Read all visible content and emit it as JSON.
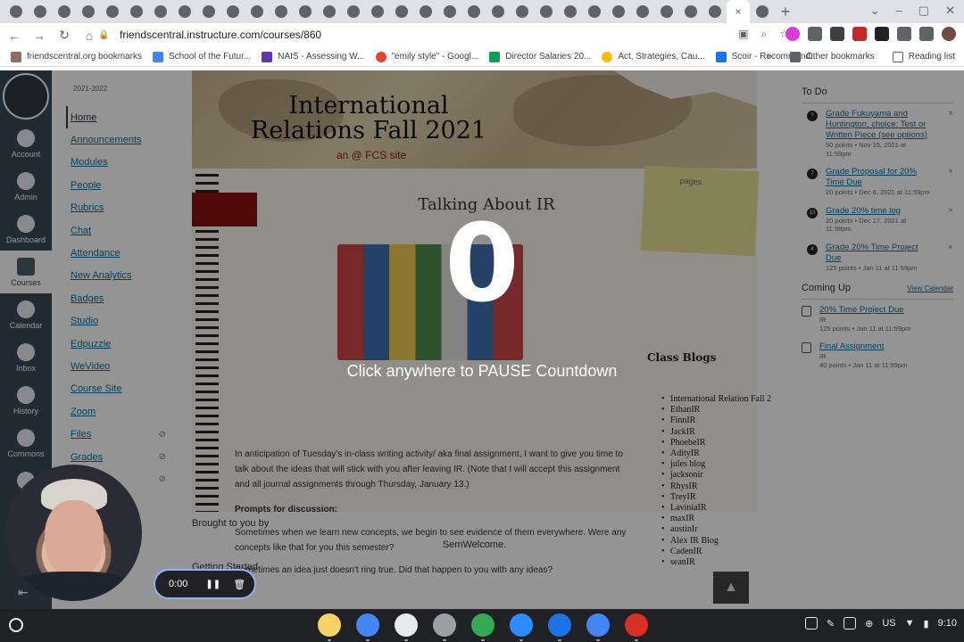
{
  "browser": {
    "tab_count": 32,
    "active_tab_close": "×",
    "new_tab": "+",
    "url": "friendscentral.instructure.com/courses/860",
    "bookmarks": [
      "friendscentral.org bookmarks",
      "School of the Futur...",
      "NAIS - Assessing W...",
      "\"emily style\" - Googl...",
      "Director Salaries 20...",
      "Act, Strategies, Cau...",
      "Scoir - Recommend..."
    ],
    "more_bookmarks": "»",
    "other_bookmarks": "Other bookmarks",
    "reading_list": "Reading list"
  },
  "global_nav": {
    "items": [
      {
        "label": "Account"
      },
      {
        "label": "Admin"
      },
      {
        "label": "Dashboard"
      },
      {
        "label": "Courses"
      },
      {
        "label": "Calendar"
      },
      {
        "label": "Inbox"
      },
      {
        "label": "History"
      },
      {
        "label": "Commons"
      },
      {
        "label": "St..."
      }
    ],
    "active": "Courses"
  },
  "course_nav": {
    "term": "2021-2022",
    "items": [
      {
        "label": "Home",
        "hidden": false
      },
      {
        "label": "Announcements",
        "hidden": false
      },
      {
        "label": "Modules",
        "hidden": false
      },
      {
        "label": "People",
        "hidden": false
      },
      {
        "label": "Rubrics",
        "hidden": false
      },
      {
        "label": "Chat",
        "hidden": false
      },
      {
        "label": "Attendance",
        "hidden": false
      },
      {
        "label": "New Analytics",
        "hidden": false
      },
      {
        "label": "Badges",
        "hidden": false
      },
      {
        "label": "Studio",
        "hidden": false
      },
      {
        "label": "Edpuzzle",
        "hidden": false
      },
      {
        "label": "WeVideo",
        "hidden": false
      },
      {
        "label": "Course Site",
        "hidden": false
      },
      {
        "label": "Zoom",
        "hidden": false
      },
      {
        "label": "Files",
        "hidden": true
      },
      {
        "label": "Grades",
        "hidden": true
      },
      {
        "label": "...ions",
        "hidden": true
      }
    ]
  },
  "page": {
    "banner_title": "International Relations Fall 2021",
    "banner_sub": "an @ FCS site",
    "sticky_note": "pages",
    "section_title": "Talking About IR",
    "intro": "In anticipation of Tuesday's in-class writing activity/ aka final assignment, I want to give you time to talk about the ideas that will stick with you after leaving IR. (Note that I will accept this assignment and all journal assignments through Thursday, January 13.)",
    "prompts_heading": "Prompts for discussion:",
    "prompt1": "Sometimes when we learn new concepts, we begin to see evidence of them everywhere. Were any concepts like that for you this semester?",
    "prompt2": "Sometimes an idea just doesn't ring true. Did that happen to you with any ideas?",
    "brought": "Brought to you by",
    "semwelcome": "SemWelcome.",
    "getting_started": "Getting Started"
  },
  "class_blogs": {
    "title": "Class Blogs",
    "items": [
      "International Relation Fall 2",
      "EthanIR",
      "FinnIR",
      "JackIR",
      "PhoebeIR",
      "AdityIR",
      "jules blog",
      "jacksonir",
      "RhysIR",
      "TreyIR",
      "LaviniaIR",
      "maxIR",
      "austinIr",
      "Alex IR Blog",
      "CadenIR",
      "seanIR"
    ]
  },
  "todo": {
    "title": "To Do",
    "items": [
      {
        "badge": "?",
        "title": "Grade Fukuyama and Huntington, choice: Test or Written Piece (see options)",
        "meta": "50 points • Nov 15, 2021 at 11:59pm"
      },
      {
        "badge": "7",
        "title": "Grade Proposal for 20% Time Due",
        "meta": "20 points • Dec 6, 2021 at 11:59pm"
      },
      {
        "badge": "13",
        "title": "Grade 20% time log",
        "meta": "20 points • Dec 17, 2021 at 11:59pm"
      },
      {
        "badge": "4",
        "title": "Grade 20% Time Project Due",
        "meta": "125 points • Jan 11 at 11:59pm"
      }
    ],
    "dismiss": "×"
  },
  "coming_up": {
    "title": "Coming Up",
    "view_calendar": "View Calendar",
    "items": [
      {
        "title": "20% Time Project Due",
        "course": "IR",
        "meta": "125 points • Jan 11 at 11:59pm"
      },
      {
        "title": "Final Assignment",
        "course": "IR",
        "meta": "40 points • Jan 11 at 11:59pm"
      }
    ]
  },
  "overlay": {
    "countdown": "0",
    "message": "Click anywhere to PAUSE Countdown"
  },
  "recorder": {
    "time": "0:00"
  },
  "shelf": {
    "locale": "US",
    "clock": "9:10",
    "apps": [
      {
        "name": "sticky-notes-app",
        "color": "#f6d365"
      },
      {
        "name": "chrome-app",
        "color": "#4285f4"
      },
      {
        "name": "photos-app",
        "color": "#e8eaed"
      },
      {
        "name": "settings-app",
        "color": "#9aa0a6"
      },
      {
        "name": "meet-app",
        "color": "#34a853"
      },
      {
        "name": "zoom-app",
        "color": "#2d8cff"
      },
      {
        "name": "files-app",
        "color": "#1a73e8"
      },
      {
        "name": "screencastify-app",
        "color": "#4285f4"
      },
      {
        "name": "recorder-app",
        "color": "#d93025"
      }
    ]
  },
  "colors": {
    "canvas_nav": "#394b58",
    "link": "#0770a3",
    "overlay": "rgba(0,0,0,0.42)"
  }
}
